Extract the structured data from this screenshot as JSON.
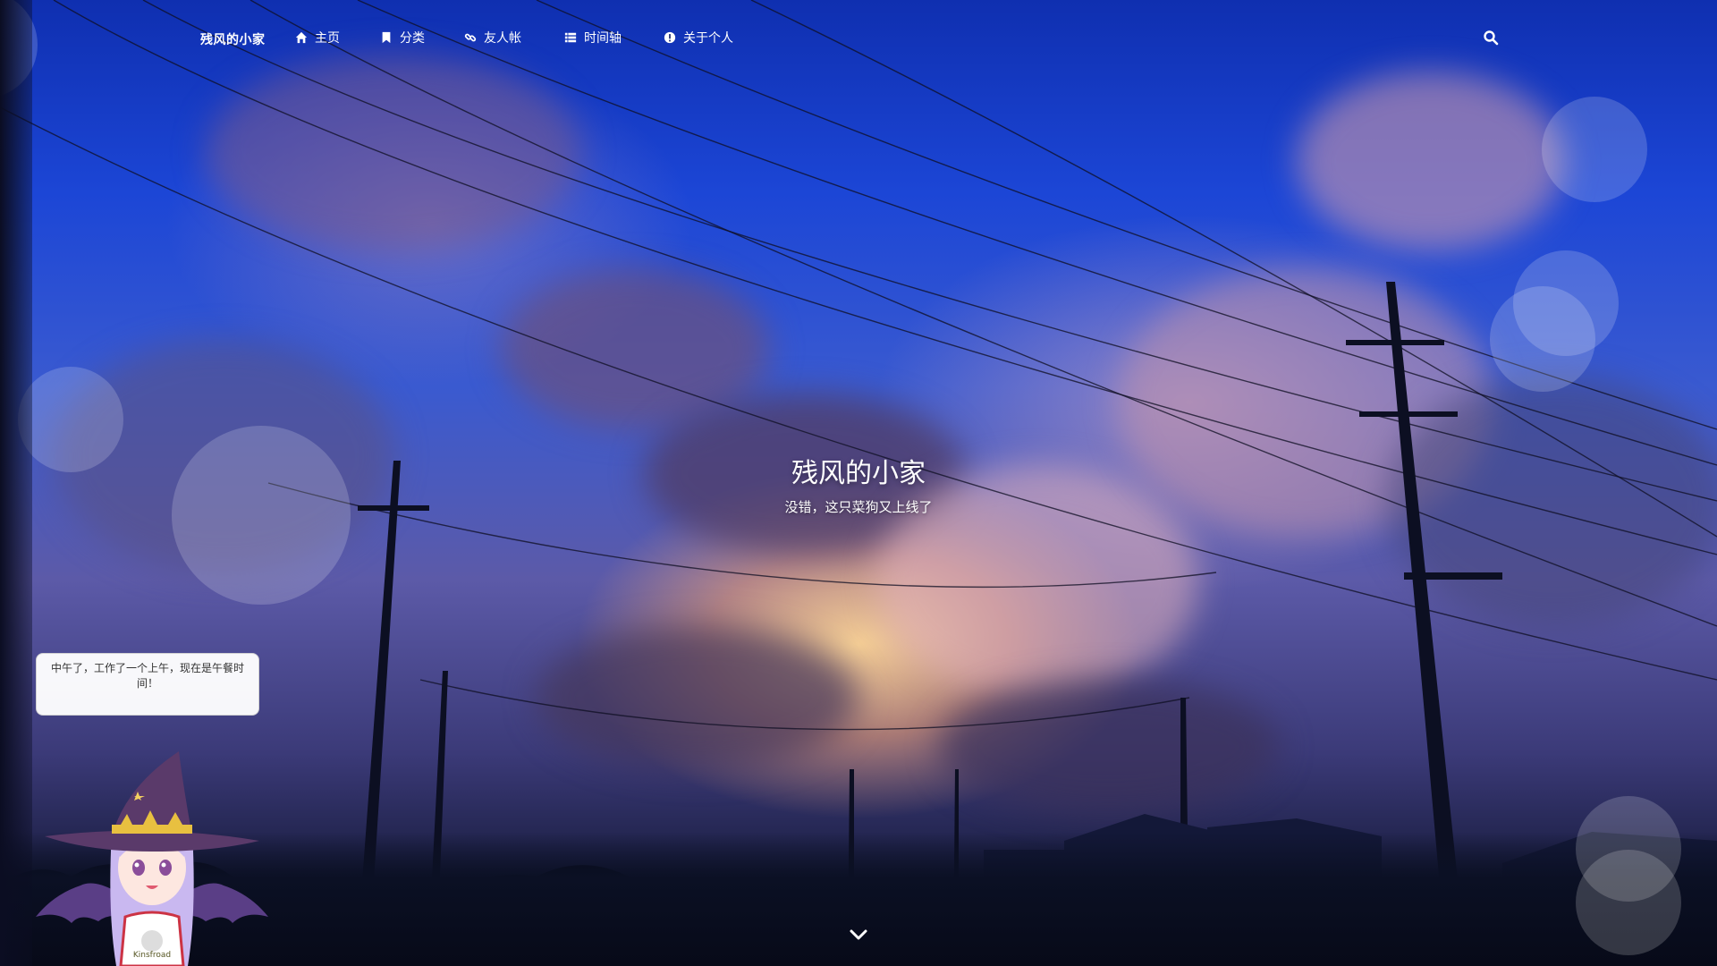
{
  "site": {
    "brand": "残风的小家"
  },
  "nav": {
    "items": [
      {
        "label": "主页",
        "icon": "home-icon"
      },
      {
        "label": "分类",
        "icon": "bookmark-icon"
      },
      {
        "label": "友人帐",
        "icon": "link-icon"
      },
      {
        "label": "时间轴",
        "icon": "list-icon"
      },
      {
        "label": "关于个人",
        "icon": "info-circle-icon"
      }
    ],
    "search_icon": "search-icon"
  },
  "hero": {
    "title": "残风的小家",
    "subtitle": "没错，这只菜狗又上线了"
  },
  "mascot": {
    "message": "中午了，工作了一个上午，现在是午餐时间！",
    "shirt_text": "Kinsfroad"
  },
  "colors": {
    "sky_top": "#0f2fb0",
    "sky_mid": "#3a5ad0",
    "glow": "#ffd696",
    "text": "#ffffff"
  }
}
